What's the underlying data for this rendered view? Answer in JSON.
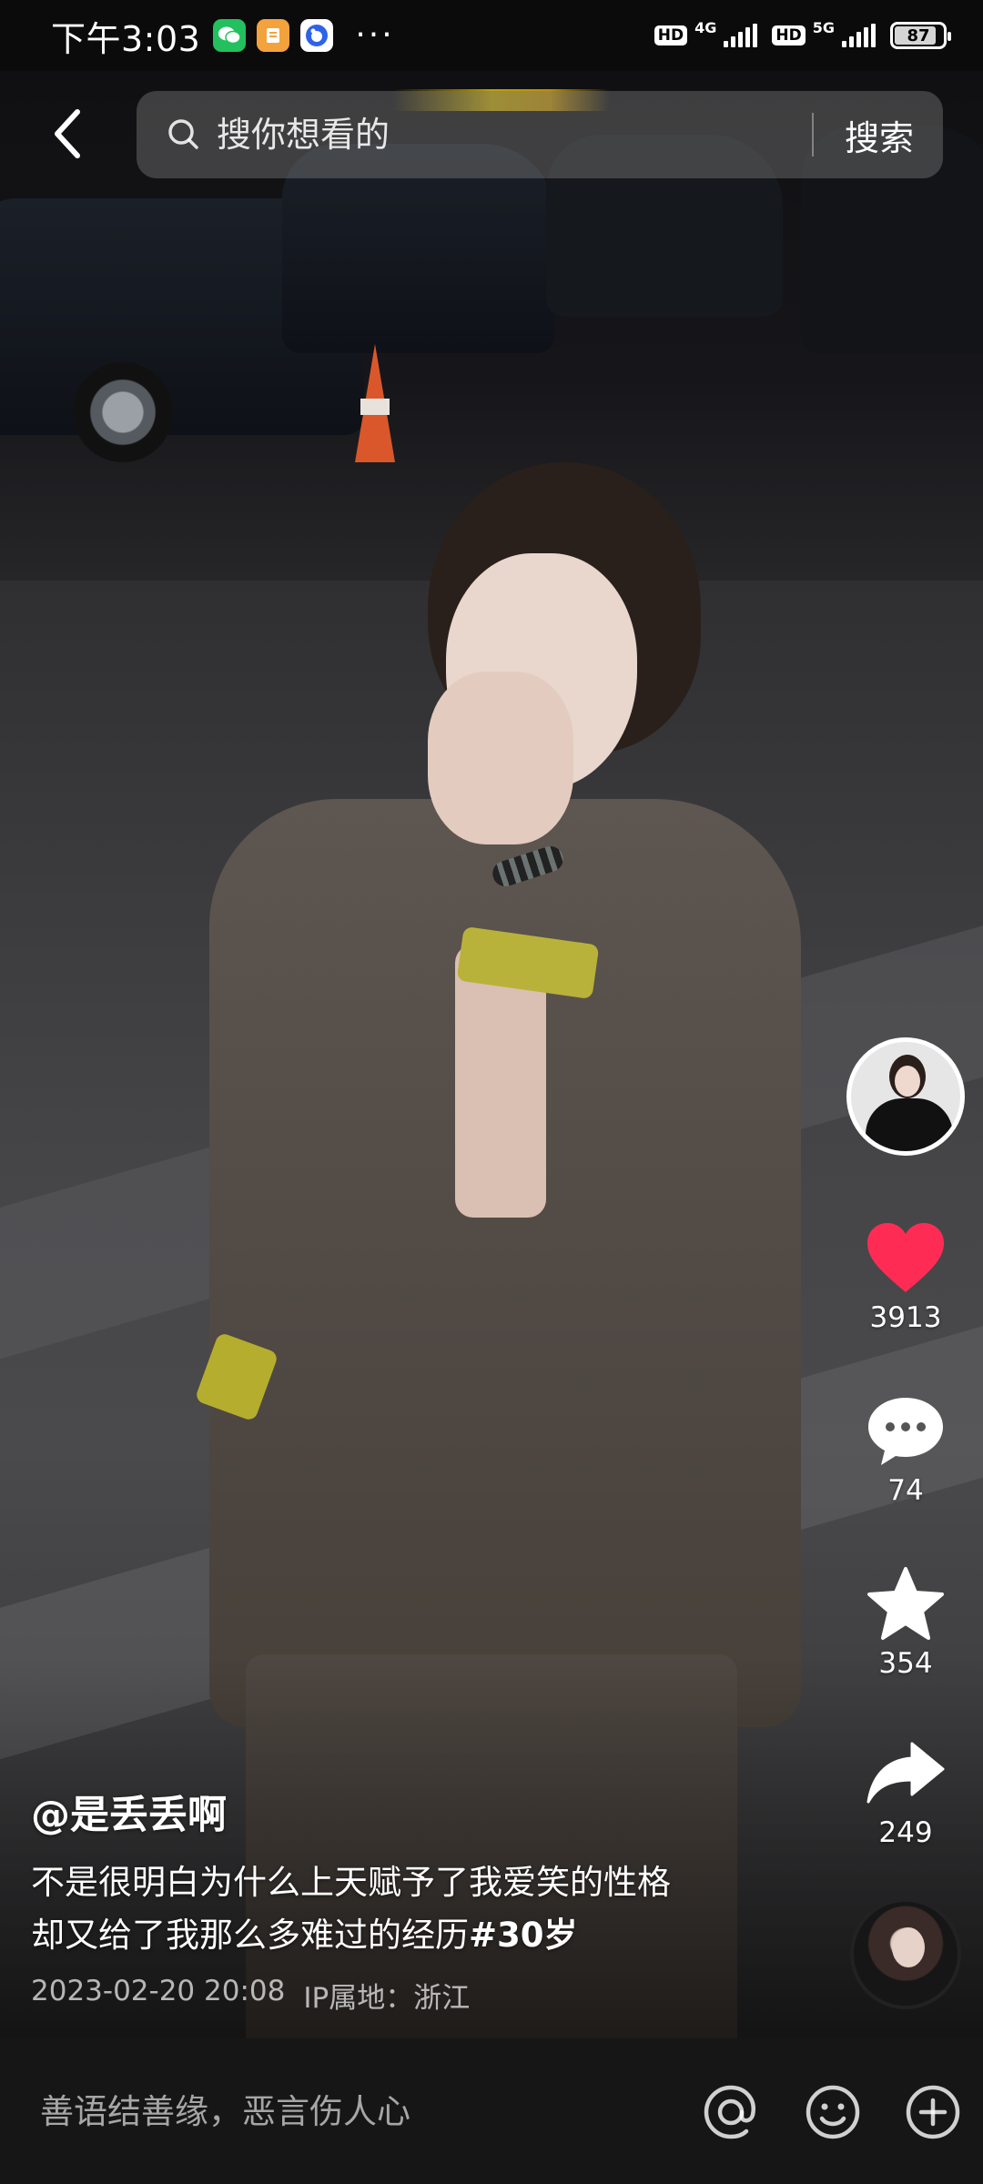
{
  "status_bar": {
    "time": "下午3:03",
    "network_1": "4G",
    "network_2": "5G",
    "hd_1": "HD",
    "hd_2": "HD",
    "battery": "87",
    "battery_level": 0.87,
    "icons": [
      "wechat-icon",
      "notes-icon",
      "baidu-icon",
      "more-dots"
    ]
  },
  "header": {
    "back_icon": "chevron-left-icon",
    "search_icon": "search-icon",
    "search_placeholder": "搜你想看的",
    "search_button": "搜索"
  },
  "actions": {
    "like_count": "3913",
    "comment_count": "74",
    "favorite_count": "354",
    "share_count": "249",
    "like_color": "#fe2c55"
  },
  "video": {
    "author": "@是丢丢啊",
    "description_line1": "不是很明白为什么上天赋予了我爱笑的性格",
    "description_line2": "却又给了我那么多难过的经历",
    "hashtag": "#30岁",
    "date": "2023-02-20 20:08",
    "location": "IP属地：浙江"
  },
  "comment_bar": {
    "placeholder": "善语结善缘，恶言伤人心",
    "icons": [
      "at-icon",
      "emoji-icon",
      "plus-icon"
    ]
  }
}
